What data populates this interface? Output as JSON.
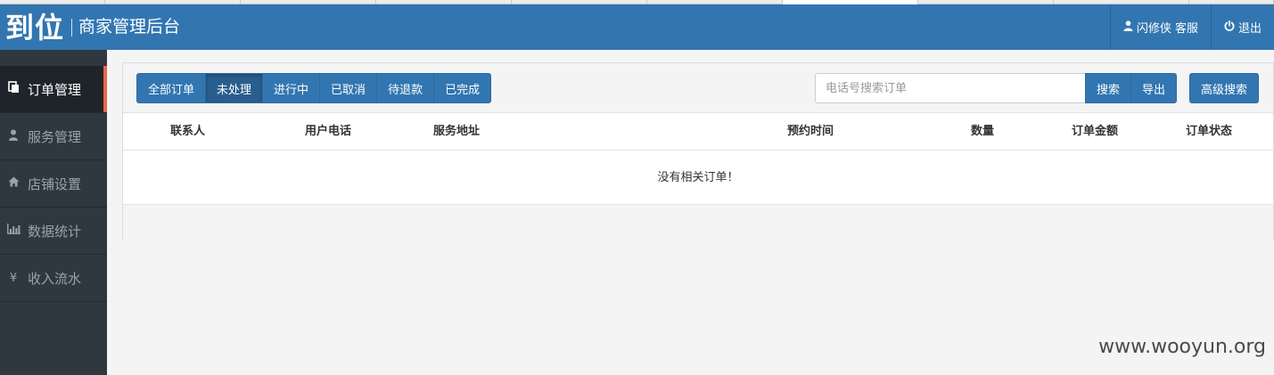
{
  "header": {
    "logo": "到位",
    "subtitle": "商家管理后台",
    "user_icon": "user-icon",
    "user_label": "闪修侠 客服",
    "logout_icon": "power-icon",
    "logout_label": "退出",
    "brand_color": "#3276b1"
  },
  "sidebar": {
    "items": [
      {
        "label": "订单管理",
        "icon": "orders-icon",
        "active": true
      },
      {
        "label": "服务管理",
        "icon": "user-service-icon",
        "active": false
      },
      {
        "label": "店铺设置",
        "icon": "home-icon",
        "active": false
      },
      {
        "label": "数据统计",
        "icon": "bar-chart-icon",
        "active": false
      },
      {
        "label": "收入流水",
        "icon": "yen-icon",
        "active": false
      }
    ],
    "accent_color": "#e8674a"
  },
  "toolbar": {
    "filters": [
      {
        "label": "全部订单",
        "active": false
      },
      {
        "label": "未处理",
        "active": true
      },
      {
        "label": "进行中",
        "active": false
      },
      {
        "label": "已取消",
        "active": false
      },
      {
        "label": "待退款",
        "active": false
      },
      {
        "label": "已完成",
        "active": false
      }
    ],
    "search_placeholder": "电话号搜索订单",
    "search_label": "搜索",
    "export_label": "导出",
    "advanced_search_label": "高级搜索"
  },
  "table": {
    "columns": [
      "联系人",
      "用户电话",
      "服务地址",
      "预约时间",
      "数量",
      "订单金额",
      "订单状态"
    ],
    "empty_message": "没有相关订单！"
  },
  "watermark": "www.wooyun.org"
}
